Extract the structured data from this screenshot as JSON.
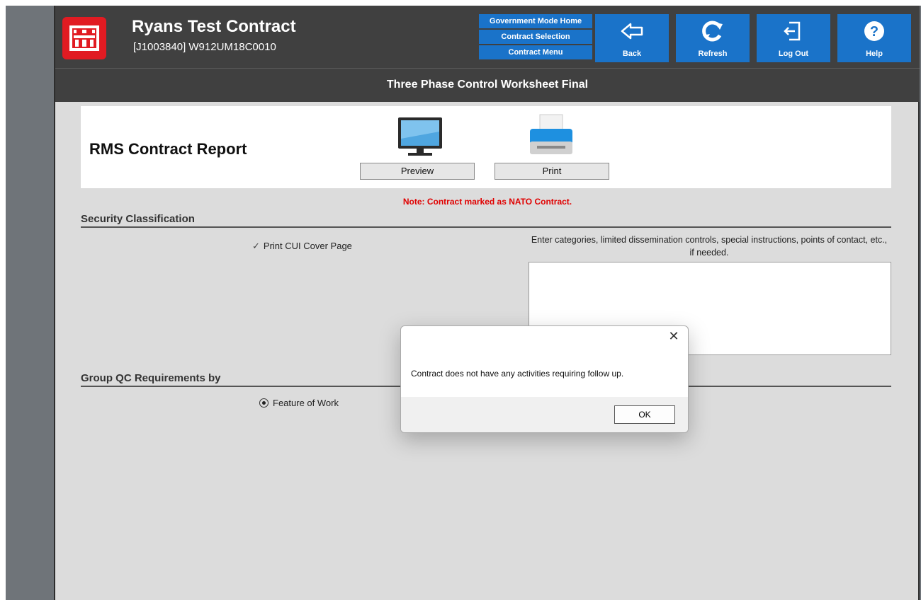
{
  "header": {
    "title": "Ryans Test Contract",
    "subtitle": "[J1003840] W912UM18C0010",
    "nav_links": [
      "Government Mode Home",
      "Contract Selection",
      "Contract Menu"
    ],
    "buttons": {
      "back": "Back",
      "refresh": "Refresh",
      "logout": "Log Out",
      "help": "Help"
    }
  },
  "page_title": "Three Phase Control Worksheet Final",
  "report": {
    "title": "RMS Contract Report",
    "preview_label": "Preview",
    "print_label": "Print"
  },
  "note": "Note: Contract marked as NATO Contract.",
  "security": {
    "header": "Security Classification",
    "checkbox_label": "Print CUI Cover Page",
    "checkbox_checked": true,
    "instructions": "Enter categories, limited dissemination controls, special instructions, points of contact, etc., if needed.",
    "textarea_value": ""
  },
  "grouping": {
    "header": "Group QC Requirements by",
    "selected_option": "Feature of Work"
  },
  "dialog": {
    "message": "Contract does not have any activities requiring follow up.",
    "ok_label": "OK"
  },
  "colors": {
    "header_bg": "#404040",
    "accent_blue": "#1a73c9",
    "logo_red": "#e11b22",
    "note_red": "#e00000"
  }
}
